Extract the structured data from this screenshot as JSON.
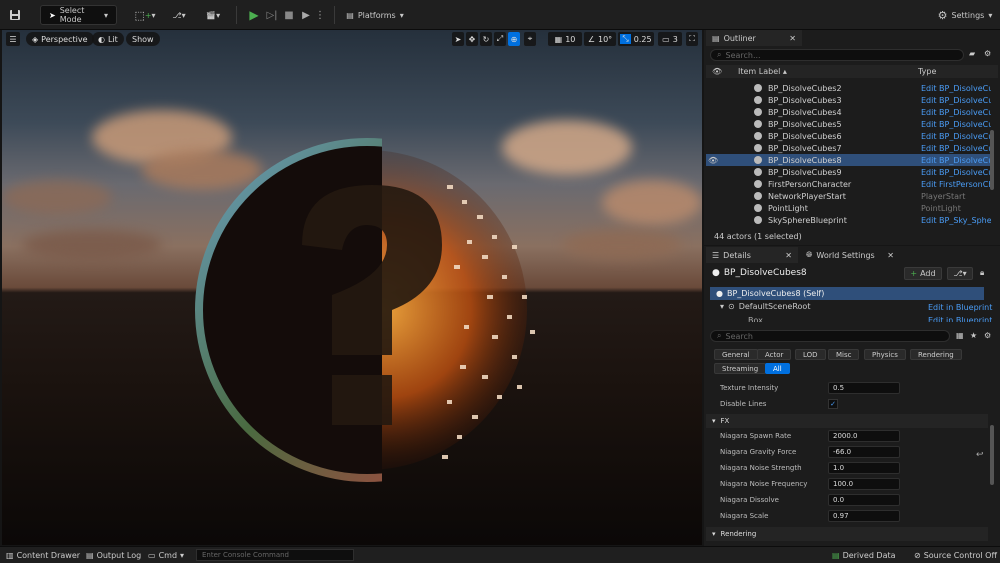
{
  "toolbar": {
    "select_mode": "Select Mode",
    "platforms": "Platforms",
    "settings": "Settings"
  },
  "viewport": {
    "perspective": "Perspective",
    "lit": "Lit",
    "show": "Show",
    "grid_snap": "10",
    "rot_snap": "10°",
    "scale_snap": "0.25",
    "camera_speed": "3"
  },
  "outliner": {
    "tab": "Outliner",
    "search_placeholder": "Search...",
    "col_label": "Item Label ▴",
    "col_type": "Type",
    "items": [
      {
        "label": "BP_DisolveCubes2",
        "type": "Edit BP_DisolveCub"
      },
      {
        "label": "BP_DisolveCubes3",
        "type": "Edit BP_DisolveCub"
      },
      {
        "label": "BP_DisolveCubes4",
        "type": "Edit BP_DisolveCub"
      },
      {
        "label": "BP_DisolveCubes5",
        "type": "Edit BP_DisolveCub"
      },
      {
        "label": "BP_DisolveCubes6",
        "type": "Edit BP_DisolveCub"
      },
      {
        "label": "BP_DisolveCubes7",
        "type": "Edit BP_DisolveCub"
      },
      {
        "label": "BP_DisolveCubes8",
        "type": "Edit BP_DisolveCub"
      },
      {
        "label": "BP_DisolveCubes9",
        "type": "Edit BP_DisolveCub"
      },
      {
        "label": "FirstPersonCharacter",
        "type": "Edit FirstPersonCha"
      },
      {
        "label": "NetworkPlayerStart",
        "type": "PlayerStart"
      },
      {
        "label": "PointLight",
        "type": "PointLight"
      },
      {
        "label": "SkySphereBlueprint",
        "type": "Edit BP_Sky_Sphere"
      }
    ],
    "status": "44 actors (1 selected)"
  },
  "details": {
    "tab": "Details",
    "tab2": "World Settings",
    "actor_name": "BP_DisolveCubes8",
    "add_label": "Add",
    "self_label": "BP_DisolveCubes8 (Self)",
    "scene_root": "DefaultSceneRoot",
    "box": "Box",
    "edit_bp": "Edit in Blueprint",
    "search_placeholder": "Search",
    "filters": [
      "General",
      "Actor",
      "LOD",
      "Misc",
      "Physics",
      "Rendering",
      "Streaming",
      "All"
    ],
    "props_top": [
      {
        "label": "Texture Intensity",
        "value": "0.5"
      },
      {
        "label": "Disable Lines",
        "value": "✓"
      }
    ],
    "fx_header": "FX",
    "fx_props": [
      {
        "label": "Niagara Spawn Rate",
        "value": "2000.0"
      },
      {
        "label": "Niagara Gravity Force",
        "value": "-66.0"
      },
      {
        "label": "Niagara Noise Strength",
        "value": "1.0"
      },
      {
        "label": "Niagara Noise Frequency",
        "value": "100.0"
      },
      {
        "label": "Niagara Dissolve",
        "value": "0.0"
      },
      {
        "label": "Niagara Scale",
        "value": "0.97"
      }
    ],
    "rendering_header": "Rendering"
  },
  "statusbar": {
    "content_drawer": "Content Drawer",
    "output_log": "Output Log",
    "cmd": "Cmd",
    "console_placeholder": "Enter Console Command",
    "derived_data": "Derived Data",
    "source_control": "Source Control Off"
  },
  "colors": {
    "accent": "#0070e0",
    "selected_row": "#2f4f7a",
    "play_green": "#4caf50"
  }
}
